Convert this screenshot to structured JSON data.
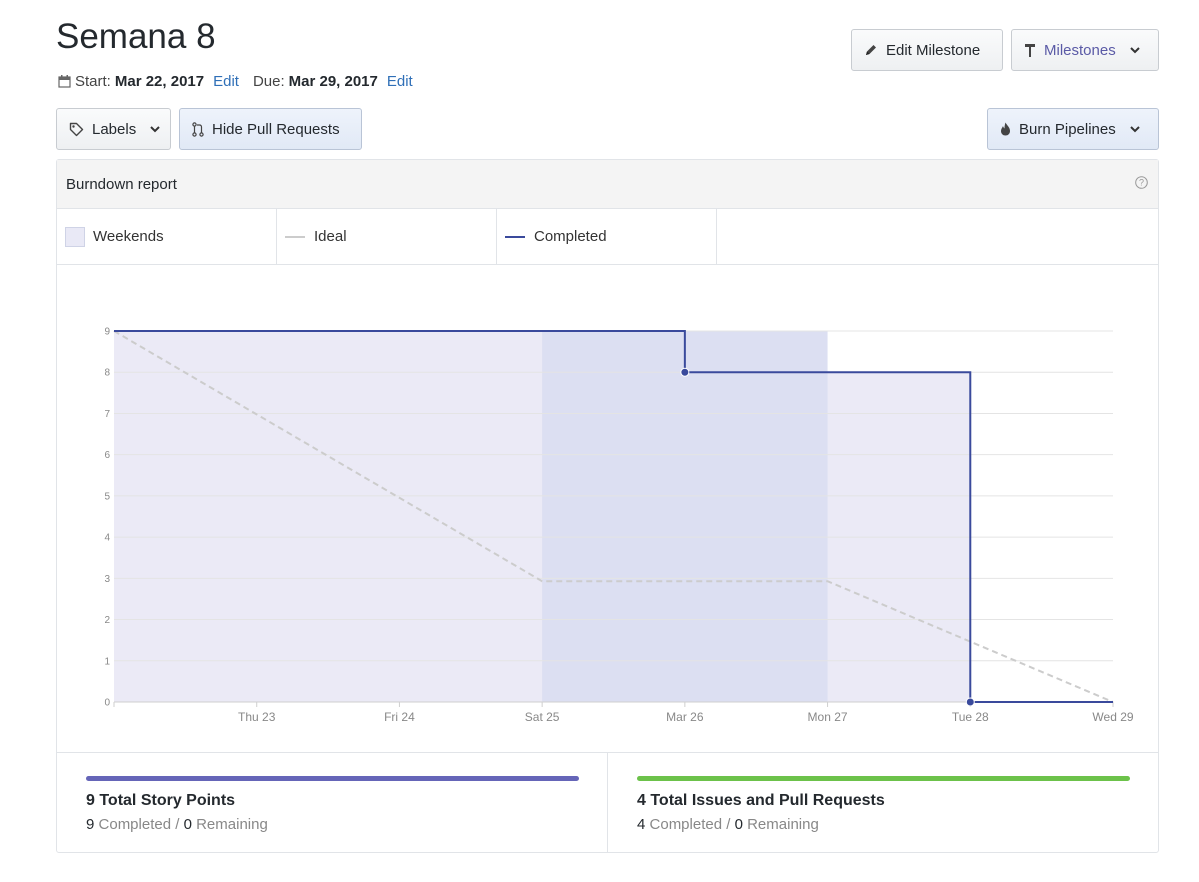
{
  "header": {
    "title": "Semana 8",
    "start_label": "Start:",
    "start_date": "Mar 22, 2017",
    "start_edit": "Edit",
    "due_label": "Due:",
    "due_date": "Mar 29, 2017",
    "due_edit": "Edit"
  },
  "toolbar": {
    "edit_milestone": "Edit Milestone",
    "milestones": "Milestones",
    "labels": "Labels",
    "hide_pull_requests": "Hide Pull Requests",
    "burn_pipelines": "Burn Pipelines"
  },
  "report": {
    "title": "Burndown report",
    "legend": [
      {
        "label": "Weekends"
      },
      {
        "label": "Ideal"
      },
      {
        "label": "Completed"
      }
    ]
  },
  "colors": {
    "completed": "#3a4a9c",
    "ideal": "#cccccc",
    "weekend_fill": "#dcdff2",
    "area_fill": "#ebeaf6",
    "story_bar": "#6565b8",
    "issues_bar": "#6cc24a"
  },
  "chart_data": {
    "type": "line",
    "title": "",
    "xlabel": "",
    "ylabel": "",
    "x_ticks": [
      "Thu 23",
      "Fri 24",
      "Sat 25",
      "Mar 26",
      "Mon 27",
      "Tue 28",
      "Wed 29"
    ],
    "y_ticks": [
      0,
      1,
      2,
      3,
      4,
      5,
      6,
      7,
      8,
      9
    ],
    "ylim": [
      0,
      9
    ],
    "xlim": [
      "2017-03-22",
      "2017-03-29"
    ],
    "grid": true,
    "weekend_band": [
      "2017-03-25",
      "2017-03-27"
    ],
    "series": [
      {
        "name": "Ideal",
        "style": "dashed",
        "points": [
          {
            "x": "2017-03-22",
            "y": 9
          },
          {
            "x": "2017-03-25",
            "y": 2.93
          },
          {
            "x": "2017-03-27",
            "y": 2.93
          },
          {
            "x": "2017-03-29",
            "y": 0
          }
        ]
      },
      {
        "name": "Completed",
        "style": "step",
        "points": [
          {
            "x": "2017-03-22",
            "y": 9
          },
          {
            "x": "2017-03-26",
            "y": 8
          },
          {
            "x": "2017-03-28",
            "y": 0
          },
          {
            "x": "2017-03-29",
            "y": 0
          }
        ]
      }
    ]
  },
  "stats": {
    "story_points": {
      "title": "9 Total Story Points",
      "completed": "9",
      "completed_label": "Completed",
      "separator": "/",
      "remaining": "0",
      "remaining_label": "Remaining"
    },
    "issues": {
      "title": "4 Total Issues and Pull Requests",
      "completed": "4",
      "completed_label": "Completed",
      "separator": "/",
      "remaining": "0",
      "remaining_label": "Remaining"
    }
  }
}
